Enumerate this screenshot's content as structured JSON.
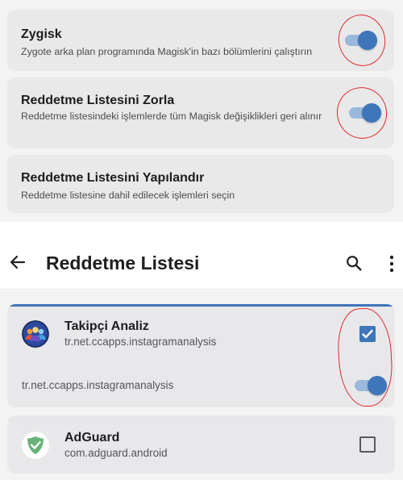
{
  "settings": {
    "zygisk": {
      "title": "Zygisk",
      "description": "Zygote arka plan programında Magisk'in bazı bölümlerini çalıştırın",
      "enabled": true
    },
    "enforce_denylist": {
      "title": "Reddetme Listesini Zorla",
      "description": "Reddetme listesindeki işlemlerde tüm Magisk değişiklikleri geri alınır",
      "enabled": true
    },
    "configure_denylist": {
      "title": "Reddetme Listesini Yapılandır",
      "description": "Reddetme listesine dahil edilecek işlemleri seçin"
    }
  },
  "appbar": {
    "title": "Reddetme Listesi",
    "back_icon": "arrow-left-icon",
    "search_icon": "search-icon",
    "more_icon": "more-vertical-icon"
  },
  "apps": [
    {
      "name": "Takipçi Analiz",
      "package": "tr.net.ccapps.instagramanalysis",
      "checked": true,
      "icon": "people-group-icon",
      "processes": [
        {
          "name": "tr.net.ccapps.instagramanalysis",
          "enabled": true
        }
      ]
    },
    {
      "name": "AdGuard",
      "package": "com.adguard.android",
      "checked": false,
      "icon": "adguard-shield-icon"
    }
  ],
  "colors": {
    "accent": "#3e76b9",
    "toggle_track": "#9bb9dc",
    "card": "#e9e9ea",
    "annotation": "#e02a2a",
    "adguard_green": "#67b279"
  }
}
